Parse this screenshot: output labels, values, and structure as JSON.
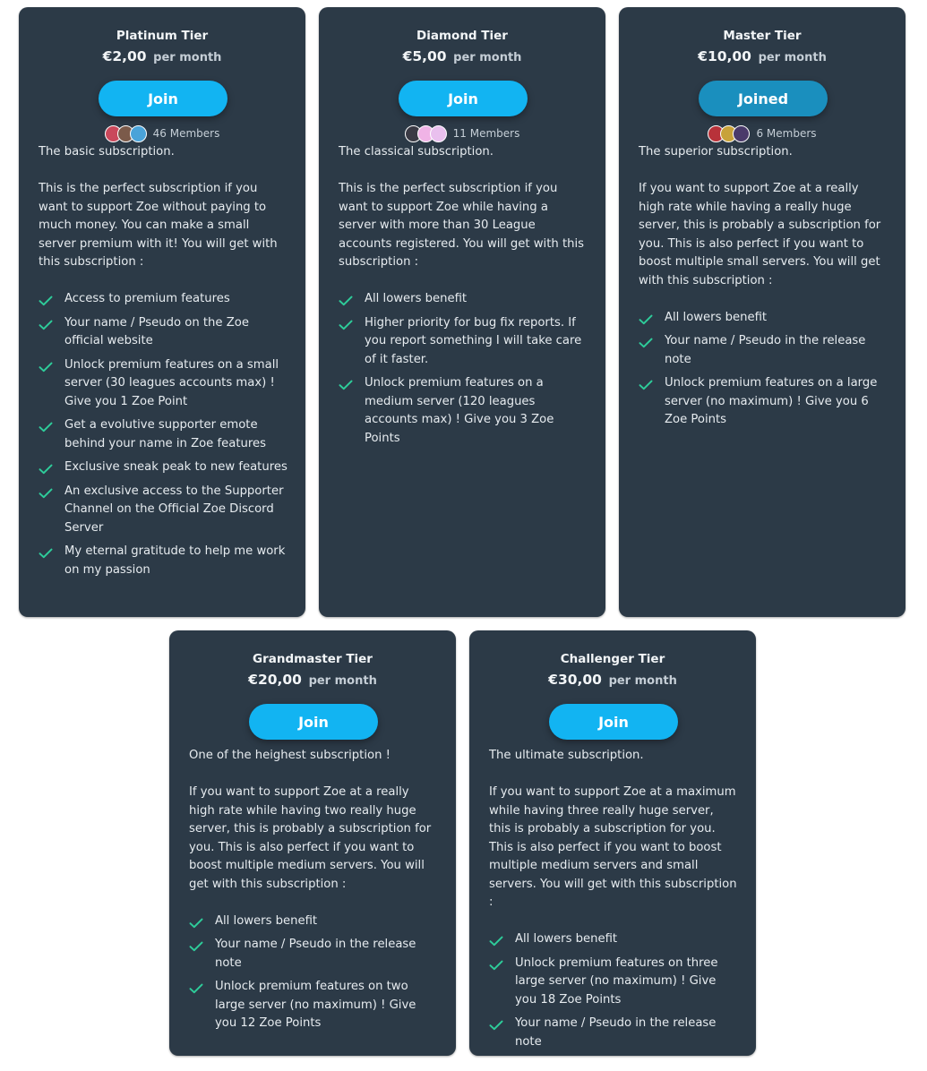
{
  "tiers": [
    {
      "name": "Platinum Tier",
      "price": "€2,00",
      "per": "per month",
      "button": "Join",
      "members": "46 Members",
      "avatar_colors": [
        "#c9485b",
        "#7b5a4a",
        "#4aa3d9"
      ],
      "desc": [
        "The basic subscription.",
        "This is the perfect subscription if you want to support Zoe without paying to much money. You can make a small server premium with it! You will get with this subscription :"
      ],
      "benefits": [
        "Access to premium features",
        "Your name / Pseudo on the Zoe official website",
        "Unlock premium features on a small server (30 leagues accounts max) ! Give you 1 Zoe Point",
        "Get a evolutive supporter emote behind your name in Zoe features",
        "Exclusive sneak peak to new features",
        "An exclusive access to the Supporter Channel on the Official Zoe Discord Server",
        "My eternal gratitude to help me work on my passion"
      ]
    },
    {
      "name": "Diamond Tier",
      "price": "€5,00",
      "per": "per month",
      "button": "Join",
      "members": "11 Members",
      "avatar_colors": [
        "#3a3a44",
        "#f0b3e6",
        "#e9c0ee"
      ],
      "desc": [
        "The classical subscription.",
        "This is the perfect subscription if you want to support Zoe while having a server with more than 30 League accounts registered. You will get with this subscription :"
      ],
      "benefits": [
        "All lowers benefit",
        "Higher priority for bug fix reports. If you report something I will take care of it faster.",
        "Unlock premium features on a medium server (120 leagues accounts max) ! Give you 3 Zoe Points"
      ]
    },
    {
      "name": "Master Tier",
      "price": "€10,00",
      "per": "per month",
      "button": "Joined",
      "members": "6 Members",
      "avatar_colors": [
        "#b8323a",
        "#c8a23a",
        "#4a3a6a"
      ],
      "desc": [
        "The superior subscription.",
        "If you want to support Zoe at a really high rate while having a really huge server, this is probably a subscription for you. This is also perfect if you want to boost multiple small servers. You will get with this subscription :"
      ],
      "benefits": [
        "All lowers benefit",
        "Your name / Pseudo in the release note",
        "Unlock premium features on a large server (no maximum) ! Give you 6 Zoe Points"
      ]
    },
    {
      "name": "Grandmaster Tier",
      "price": "€20,00",
      "per": "per month",
      "button": "Join",
      "members": "",
      "avatar_colors": [],
      "desc": [
        "One of the heighest subscription !",
        "If you want to support Zoe at a really high rate while having two really huge server, this is probably a subscription for you. This is also perfect if you want to boost multiple medium servers. You will get with this subscription :"
      ],
      "benefits": [
        "All lowers benefit",
        "Your name / Pseudo in the release note",
        "Unlock premium features on two large server (no maximum) ! Give you 12 Zoe Points"
      ]
    },
    {
      "name": "Challenger Tier",
      "price": "€30,00",
      "per": "per month",
      "button": "Join",
      "members": "",
      "avatar_colors": [],
      "desc": [
        "The ultimate subscription.",
        "If you want to support Zoe at a maximum while having three really huge server, this is probably a subscription for you. This is also perfect if you want to boost multiple medium servers and small servers. You will get with this subscription :"
      ],
      "benefits": [
        "All lowers benefit",
        "Unlock premium features on three large server (no maximum) ! Give you 18 Zoe Points",
        "Your name / Pseudo in the release note"
      ]
    }
  ],
  "colors": {
    "card_bg": "#2c3a47",
    "button": "#12b4f2",
    "button_joined": "#1a8fbe",
    "check": "#2ecc9a"
  }
}
